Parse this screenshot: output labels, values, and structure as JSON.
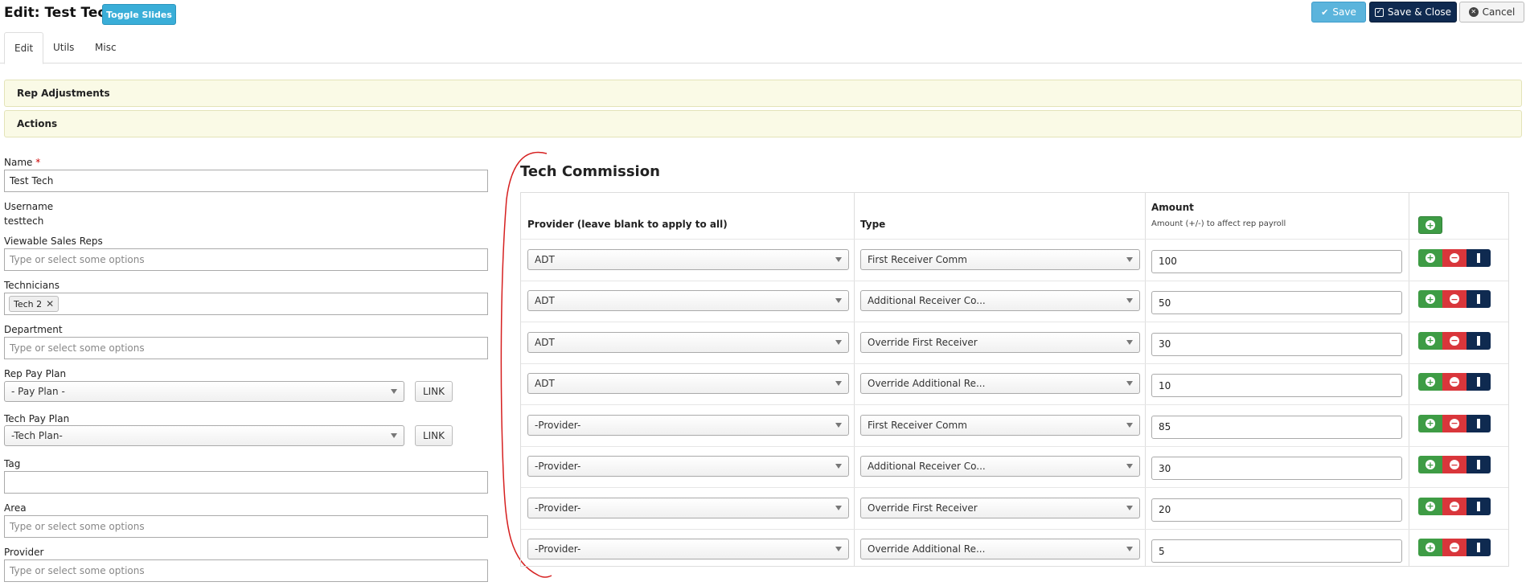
{
  "header": {
    "title": "Edit: Test Tech",
    "toggle_label": "Toggle Slides",
    "save_label": "Save",
    "save_close_label": "Save & Close",
    "cancel_label": "Cancel"
  },
  "tabs": [
    {
      "label": "Edit",
      "active": true
    },
    {
      "label": "Utils",
      "active": false
    },
    {
      "label": "Misc",
      "active": false
    }
  ],
  "panels": [
    {
      "label": "Rep Adjustments"
    },
    {
      "label": "Actions"
    }
  ],
  "form": {
    "name_label": "Name",
    "name_required_mark": "*",
    "name_value": "Test Tech",
    "username_label": "Username",
    "username_value": "testtech",
    "viewable_label": "Viewable Sales Reps",
    "viewable_placeholder": "Type or select some options",
    "technicians_label": "Technicians",
    "technicians_chip": "Tech 2",
    "department_label": "Department",
    "department_placeholder": "Type or select some options",
    "rep_pay_plan_label": "Rep Pay Plan",
    "rep_pay_plan_value": "- Pay Plan -",
    "rep_link_label": "LINK",
    "tech_pay_plan_label": "Tech Pay Plan",
    "tech_pay_plan_value": "-Tech Plan-",
    "tech_link_label": "LINK",
    "tag_label": "Tag",
    "tag_value": "",
    "area_label": "Area",
    "area_placeholder": "Type or select some options",
    "provider_label": "Provider",
    "provider_placeholder": "Type or select some options"
  },
  "commission": {
    "title": "Tech Commission",
    "col_provider": "Provider (leave blank to apply to all)",
    "col_type": "Type",
    "col_amount": "Amount",
    "col_amount_sub": "Amount (+/-) to affect rep payroll",
    "rows": [
      {
        "provider": "ADT",
        "type": "First Receiver Comm",
        "amount": "100"
      },
      {
        "provider": "ADT",
        "type": "Additional Receiver Co...",
        "amount": "50"
      },
      {
        "provider": "ADT",
        "type": "Override First Receiver",
        "amount": "30"
      },
      {
        "provider": "ADT",
        "type": "Override Additional Re...",
        "amount": "10"
      },
      {
        "provider": "-Provider-",
        "type": "First Receiver Comm",
        "amount": "85"
      },
      {
        "provider": "-Provider-",
        "type": "Additional Receiver Co...",
        "amount": "30"
      },
      {
        "provider": "-Provider-",
        "type": "Override First Receiver",
        "amount": "20"
      },
      {
        "provider": "-Provider-",
        "type": "Override Additional Re...",
        "amount": "5"
      }
    ]
  },
  "icons": {
    "check": "check-icon",
    "checkbox": "checkbox-icon",
    "close": "close-circle-icon",
    "plus": "plus-circle-icon",
    "minus": "minus-circle-icon",
    "move": "move-handle-icon"
  },
  "colors": {
    "primary_dark": "#0f2a50",
    "info": "#3aaed8",
    "success": "#3e9c45",
    "danger": "#d9363b",
    "panel_bg": "#fafae6",
    "annotation": "#d62020"
  }
}
